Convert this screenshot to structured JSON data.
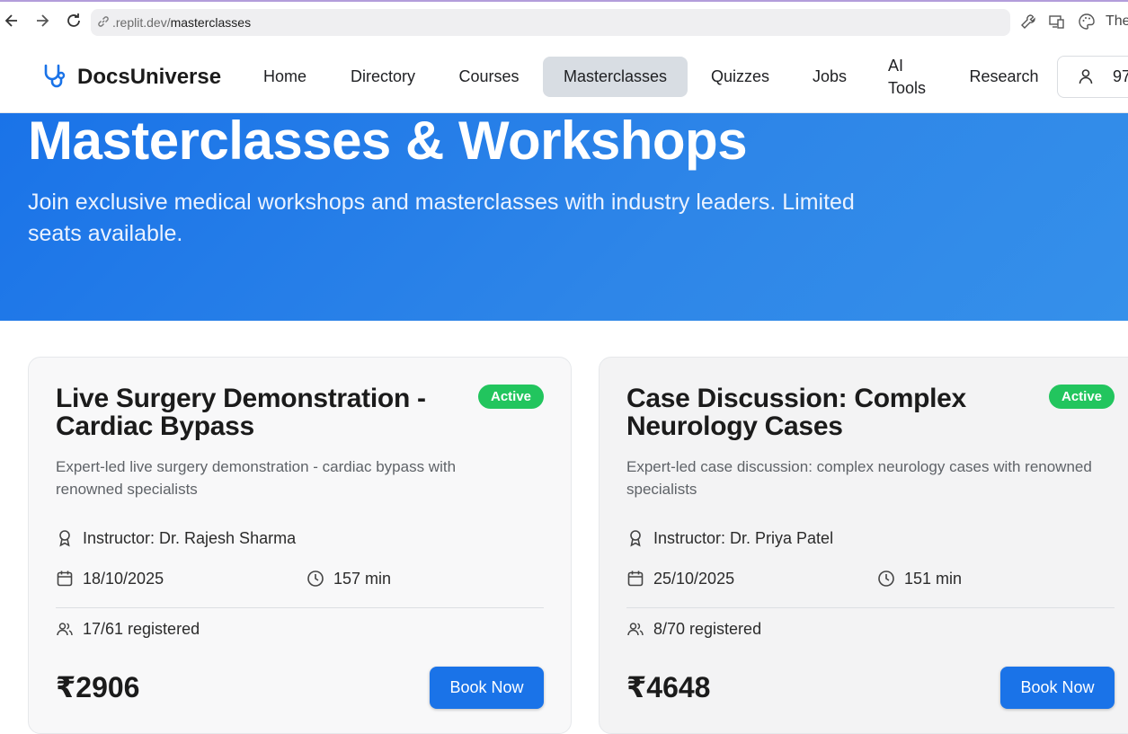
{
  "browser": {
    "url_domain": ".replit.dev/",
    "url_path": "masterclasses",
    "truncated_tab_text": "The"
  },
  "header": {
    "logo_text": "DocsUniverse",
    "nav": {
      "home": "Home",
      "directory": "Directory",
      "courses": "Courses",
      "masterclasses": "Masterclasses",
      "quizzes": "Quizzes",
      "jobs": "Jobs",
      "ai_tools_line1": "AI",
      "ai_tools_line2": "Tools",
      "research": "Research"
    },
    "account_text": "97",
    "active_nav": "Masterclasses"
  },
  "hero": {
    "title": "Masterclasses & Workshops",
    "subtitle": "Join exclusive medical workshops and masterclasses with industry leaders. Limited seats available."
  },
  "colors": {
    "primary": "#1a73e8",
    "active_badge": "#22c55e",
    "nav_active_bg": "#d8dde3"
  },
  "cards": [
    {
      "title": "Live Surgery Demonstration - Cardiac Bypass",
      "status": "Active",
      "description": "Expert-led live surgery demonstration - cardiac bypass with renowned specialists",
      "instructor": "Instructor: Dr. Rajesh Sharma",
      "date": "18/10/2025",
      "duration": "157 min",
      "registered": "17/61 registered",
      "price": "₹2906",
      "button": "Book Now"
    },
    {
      "title": "Case Discussion: Complex Neurology Cases",
      "status": "Active",
      "description": "Expert-led case discussion: complex neurology cases with renowned specialists",
      "instructor": "Instructor: Dr. Priya Patel",
      "date": "25/10/2025",
      "duration": "151 min",
      "registered": "8/70 registered",
      "price": "₹4648",
      "button": "Book Now"
    }
  ]
}
